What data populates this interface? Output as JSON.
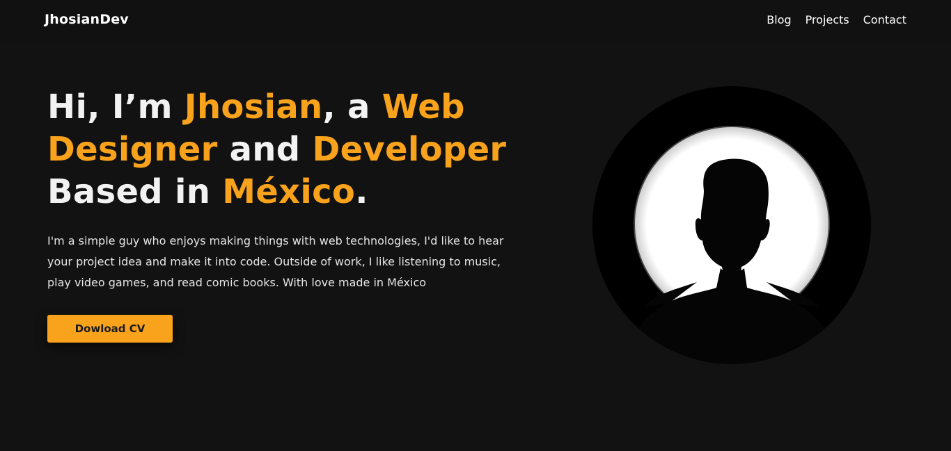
{
  "nav": {
    "brand": "JhosianDev",
    "links": [
      "Blog",
      "Projects",
      "Contact"
    ]
  },
  "hero": {
    "headline": [
      {
        "text": "Hi, I’m ",
        "accent": false
      },
      {
        "text": "Jhosian",
        "accent": true
      },
      {
        "text": ", a ",
        "accent": false
      },
      {
        "text": "Web Designer",
        "accent": true
      },
      {
        "text": " and ",
        "accent": false
      },
      {
        "text": "Developer",
        "accent": true
      },
      {
        "text": " Based in ",
        "accent": false
      },
      {
        "text": "México",
        "accent": true
      },
      {
        "text": ".",
        "accent": false
      }
    ],
    "bio": "I'm a simple guy who enjoys making things with web technologies, I'd like to hear your project idea and make it into code. Outside of work, I like listening to music, play video games, and read comic books. With love made in México",
    "cv_button": "Dowload CV"
  },
  "colors": {
    "background": "#121212",
    "accent": "#f9a21b",
    "text": "#f2f2f2"
  },
  "portrait": {
    "icon": "person-silhouette-icon"
  }
}
